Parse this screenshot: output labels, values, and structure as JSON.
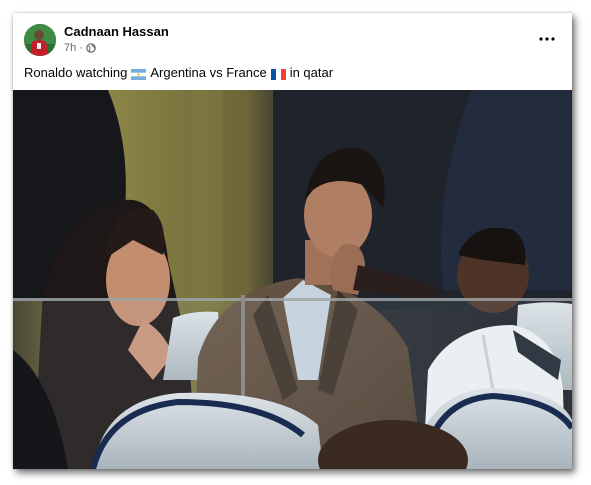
{
  "post": {
    "author": "Cadnaan Hassan",
    "timestamp": "7h",
    "separator": "·",
    "privacy_icon": "globe-icon",
    "more_icon": "more-options-icon",
    "caption": {
      "part1": "Ronaldo watching",
      "flag1": "argentina-flag-icon",
      "part2": "Argentina vs France",
      "flag2": "france-flag-icon",
      "part3": "in qatar"
    },
    "photo_icon": "stadium-photo"
  },
  "colors": {
    "card_bg": "#ffffff",
    "author_text": "#050505",
    "meta_text": "#65676b",
    "argentina_blue": "#74acdf",
    "france_blue": "#0055a4",
    "france_red": "#ef4135"
  }
}
